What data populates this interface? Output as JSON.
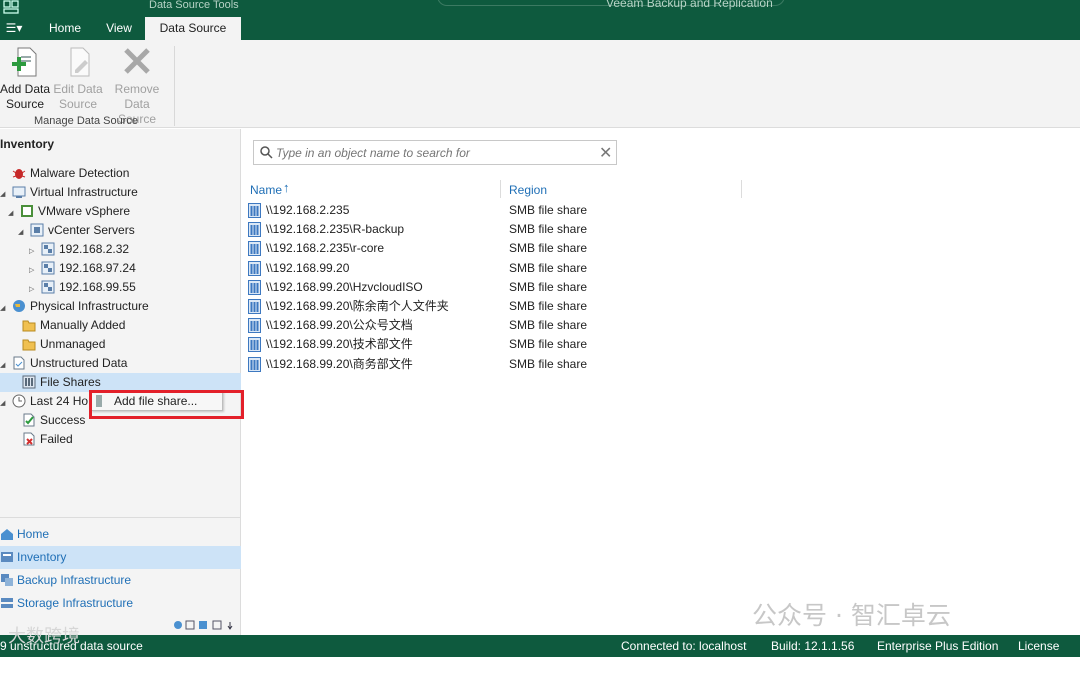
{
  "titlebar": {
    "tools_label": "Data Source Tools",
    "window_title": "Veeam Backup and Replication",
    "menu_button": "☰▾",
    "tabs": [
      {
        "label": "Home"
      },
      {
        "label": "View"
      },
      {
        "label": "Data Source"
      }
    ]
  },
  "ribbon": {
    "add": "Add Data Source",
    "edit": "Edit Data Source",
    "remove": "Remove Data Source",
    "group_label": "Manage Data Source"
  },
  "inventory": {
    "header": "Inventory",
    "tree": [
      {
        "label": "Malware Detection",
        "icon": "bug-icon"
      },
      {
        "label": "Virtual Infrastructure",
        "icon": "vi-icon"
      },
      {
        "label": "VMware vSphere",
        "icon": "vsphere-icon"
      },
      {
        "label": "vCenter Servers",
        "icon": "vcenter-icon"
      },
      {
        "label": "192.168.2.32",
        "icon": "vc-server-icon"
      },
      {
        "label": "192.168.97.24",
        "icon": "vc-server-icon"
      },
      {
        "label": "192.168.99.55",
        "icon": "vc-server-icon"
      },
      {
        "label": "Physical Infrastructure",
        "icon": "globe-icon"
      },
      {
        "label": "Manually Added",
        "icon": "folder-icon"
      },
      {
        "label": "Unmanaged",
        "icon": "folder-icon"
      },
      {
        "label": "Unstructured Data",
        "icon": "doc-icon"
      },
      {
        "label": "File Shares",
        "icon": "share-icon"
      },
      {
        "label": "Last 24 Ho",
        "icon": "clock-icon"
      },
      {
        "label": "Success",
        "icon": "success-icon"
      },
      {
        "label": "Failed",
        "icon": "failed-icon"
      }
    ]
  },
  "context_menu": {
    "item": "Add file share..."
  },
  "nav": {
    "home": "Home",
    "inventory": "Inventory",
    "backup_infra": "Backup Infrastructure",
    "storage_infra": "Storage Infrastructure"
  },
  "search": {
    "placeholder": "Type in an object name to search for"
  },
  "table": {
    "columns": [
      "Name",
      "Region"
    ],
    "rows": [
      {
        "name": "\\\\192.168.2.235",
        "region": "SMB file share"
      },
      {
        "name": "\\\\192.168.2.235\\R-backup",
        "region": "SMB file share"
      },
      {
        "name": "\\\\192.168.2.235\\r-core",
        "region": "SMB file share"
      },
      {
        "name": "\\\\192.168.99.20",
        "region": "SMB file share"
      },
      {
        "name": "\\\\192.168.99.20\\HzvcloudISO",
        "region": "SMB file share"
      },
      {
        "name": "\\\\192.168.99.20\\陈余南个人文件夹",
        "region": "SMB file share"
      },
      {
        "name": "\\\\192.168.99.20\\公众号文档",
        "region": "SMB file share"
      },
      {
        "name": "\\\\192.168.99.20\\技术部文件",
        "region": "SMB file share"
      },
      {
        "name": "\\\\192.168.99.20\\商务部文件",
        "region": "SMB file share"
      }
    ]
  },
  "statusbar": {
    "left": "9 unstructured data source",
    "connected": "Connected to: localhost",
    "build": "Build: 12.1.1.56",
    "edition": "Enterprise Plus Edition",
    "license": "License expi"
  },
  "watermark": {
    "main": "公众号 · 智汇卓云",
    "left": "大数跨境"
  },
  "colors": {
    "brand": "#0e5a3e",
    "selection": "#cde3f7",
    "link": "#1f6fb6",
    "highlight": "#e3202a"
  }
}
